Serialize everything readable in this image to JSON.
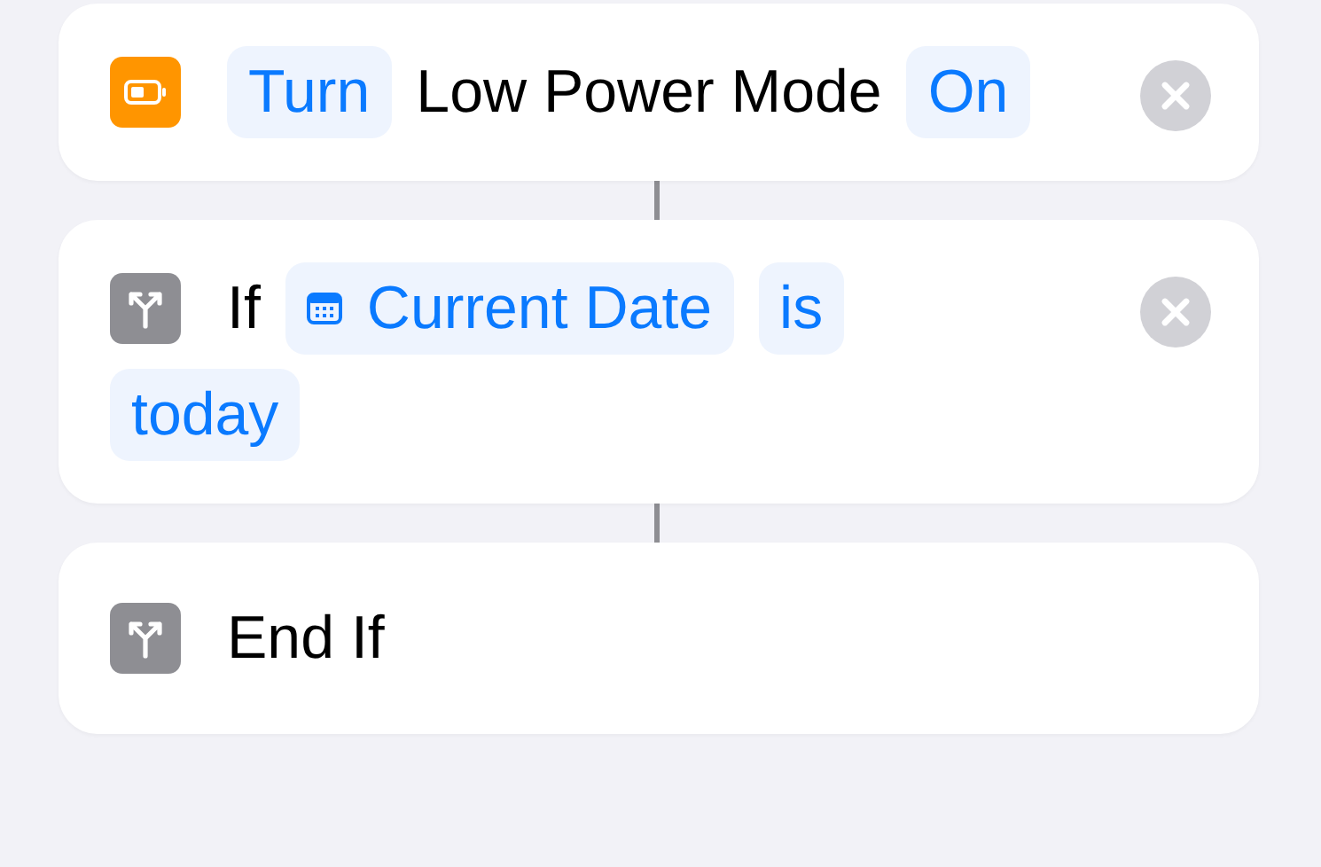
{
  "actions": [
    {
      "kind": "action",
      "tokens": [
        {
          "kind": "param",
          "text": "Turn"
        },
        {
          "kind": "plain",
          "text": "Low Power Mode"
        },
        {
          "kind": "param",
          "text": "On"
        }
      ]
    },
    {
      "kind": "if",
      "tokens": [
        {
          "kind": "plain",
          "text": "If"
        },
        {
          "kind": "date",
          "text": "Current Date"
        },
        {
          "kind": "param",
          "text": "is"
        },
        {
          "kind": "param",
          "text": "today"
        }
      ]
    },
    {
      "kind": "end",
      "tokens": [
        {
          "kind": "plain",
          "text": "End If"
        }
      ]
    }
  ]
}
